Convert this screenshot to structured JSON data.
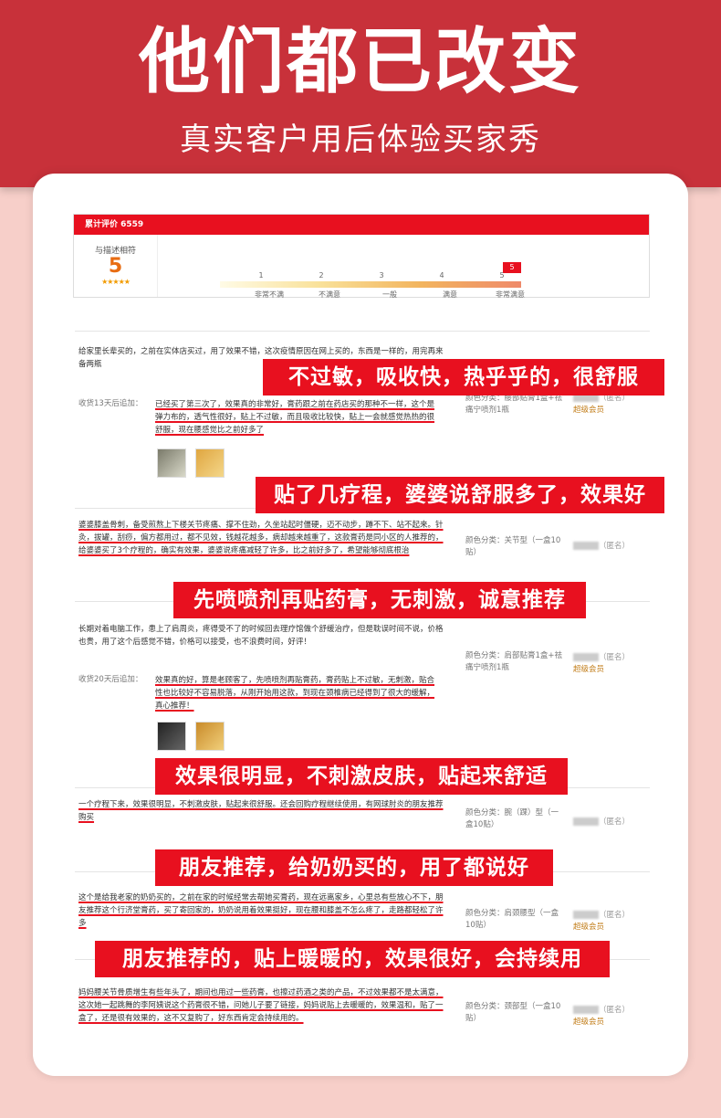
{
  "header": {
    "title": "他们都已改变",
    "subtitle": "真实客户用后体验买家秀"
  },
  "summary": {
    "total_label": "累计评价 6559",
    "match_label": "与描述相符",
    "score": "5",
    "stars": "★★★★★",
    "scale_numbers": [
      "1",
      "2",
      "3",
      "4",
      "5"
    ],
    "scale_words": [
      "非常不满",
      "不满意",
      "一般",
      "满意",
      "非常满意"
    ],
    "selected": "5"
  },
  "reviews": [
    {
      "text": "给家里长辈买的，之前在实体店买过，用了效果不错，这次疫情原因在网上买的，东西是一样的，用完再来备两瓶",
      "followup_label": "收货13天后追加：",
      "followup_text": "已经买了第三次了，效果真的非常好，膏药跟之前在药店买的那种不一样，这个是弹力布的，透气性很好，贴上不过敏，而且吸收比较快，贴上一会就感觉热热的很舒服，现在腰感觉比之前好多了",
      "sku": "颜色分类：腰部贴膏1盒+祛痛宁喷剂1瓶",
      "user": "（匿名）",
      "badge": "超级会员"
    },
    {
      "text": "婆婆膝盖骨刺，备受煎熬上下楼关节疼痛、撑不住劲，久坐站起时僵硬，迈不动步，蹲不下、站不起来。针灸，拔罐，刮痧，偏方都用过，都不见效，钱越花越多，病却越来越重了，这款膏药是同小区的人推荐的，给婆婆买了3个疗程的，确实有效果，婆婆说疼痛减轻了许多，比之前好多了，希望能够彻底根治",
      "sku": "颜色分类：关节型（一盒10贴）",
      "user": "（匿名）"
    },
    {
      "text": "长期对着电脑工作，患上了肩周炎，疼得受不了的时候回去理疗馆做个舒缓治疗，但是耽误时间不说，价格也贵，用了这个后感觉不错，价格可以接受，也不浪费时间，好评！",
      "followup_label": "收货20天后追加：",
      "followup_text": "效果真的好，算是老顾客了，先喷喷剂再贴膏药，膏药贴上不过敏，无刺激，贴合性也比较好不容易脱落，从刚开始用这款，到现在颈椎病已经得到了很大的缓解，真心推荐！",
      "sku": "颜色分类：肩部贴膏1盒+祛痛宁喷剂1瓶",
      "user": "（匿名）",
      "badge": "超级会员"
    },
    {
      "text": "一个疗程下来，效果很明显，不刺激皮肤，贴起来很舒服。还会回购疗程继续使用，有网球肘炎的朋友推荐购买",
      "sku": "颜色分类：腕（踝）型（一盒10贴）",
      "user": "（匿名）"
    },
    {
      "text": "这个是给我老家的奶奶买的，之前在家的时候经常去帮她买膏药，现在远离家乡，心里总有些放心不下，朋友推荐这个行济堂膏药，买了寄回家的，奶奶说用着效果挺好，现在腰和膝盖不怎么疼了，走路都轻松了许多",
      "sku": "颜色分类：肩颈腰型（一盒10贴）",
      "user": "（匿名）",
      "badge": "超级会员"
    },
    {
      "text": "妈妈腰关节骨质增生有些年头了，期间也用过一些药膏，也擦过药酒之类的产品，不过效果都不是太满意，这次她一起跳舞的李阿姨说这个药膏很不错，问她儿子要了链接，妈妈说贴上去暖暖的，效果温和，贴了一盒了，还是很有效果的，这不又复购了，好东西肯定会持续用的。",
      "sku": "颜色分类：颈部型（一盒10贴）",
      "user": "（匿名）",
      "badge": "超级会员"
    }
  ],
  "banners": [
    "不过敏，吸收快，热乎乎的，很舒服",
    "贴了几疗程，婆婆说舒服多了，效果好",
    "先喷喷剂再贴药膏，无刺激，诚意推荐",
    "效果很明显，不刺激皮肤，贴起来舒适",
    "朋友推荐，给奶奶买的，用了都说好",
    "朋友推荐的，贴上暖暖的，效果很好，会持续用"
  ]
}
